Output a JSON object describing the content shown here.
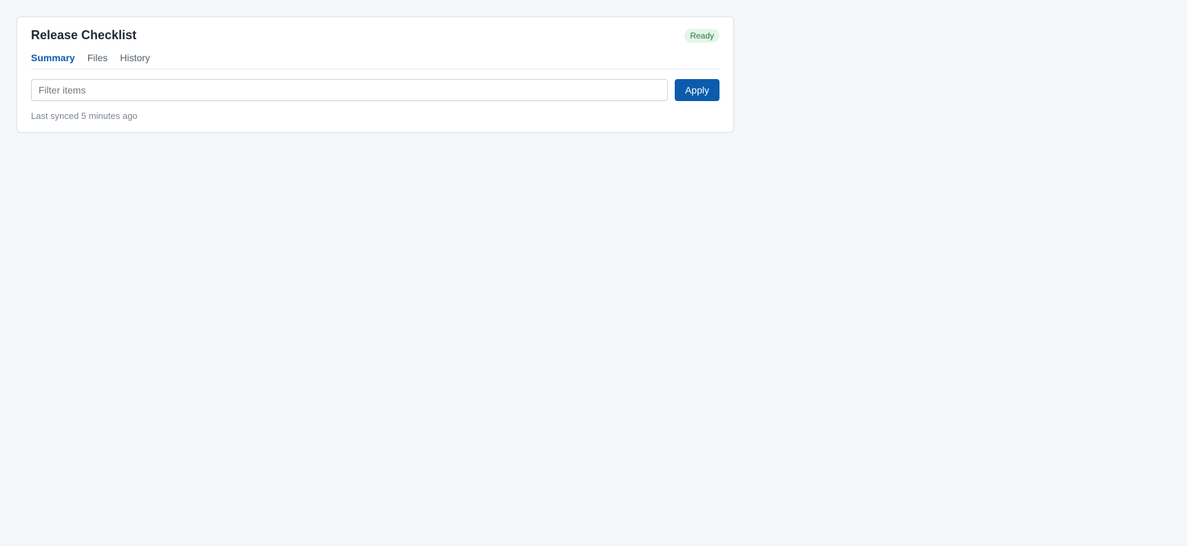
{
  "panel": {
    "title": "Release Checklist",
    "status": "Ready",
    "tabs": [
      "Summary",
      "Files",
      "History"
    ],
    "search_placeholder": "Filter items",
    "apply_label": "Apply",
    "note": "Last synced 5 minutes ago"
  }
}
